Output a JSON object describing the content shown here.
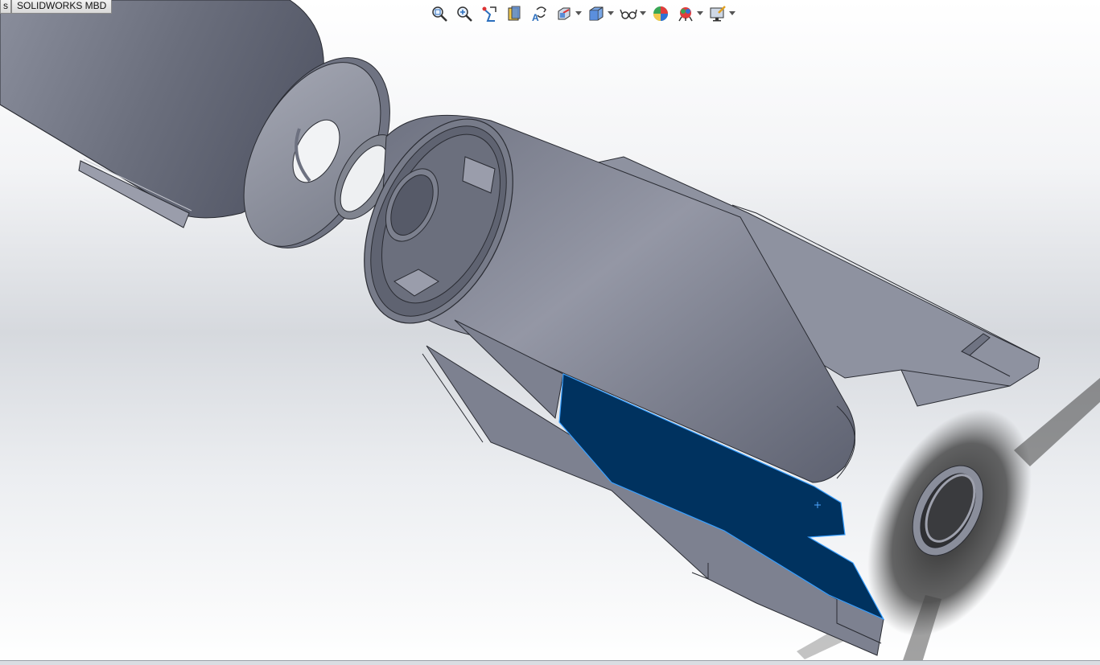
{
  "tabs": [
    {
      "label": "s"
    },
    {
      "label": "SOLIDWORKS MBD"
    }
  ],
  "heads_up_toolbar": [
    {
      "icon": "zoom-to-fit-icon"
    },
    {
      "icon": "zoom-to-area-icon"
    },
    {
      "icon": "previous-view-icon"
    },
    {
      "icon": "section-view-icon"
    },
    {
      "icon": "dynamic-annotation-views-icon"
    },
    {
      "icon": "view-orientation-icon",
      "dropdown": true
    },
    {
      "icon": "display-style-icon",
      "dropdown": true
    },
    {
      "icon": "hide-show-items-icon",
      "dropdown": true
    },
    {
      "icon": "edit-appearance-icon"
    },
    {
      "icon": "apply-scene-icon",
      "dropdown": true
    },
    {
      "icon": "view-settings-icon",
      "dropdown": true
    }
  ],
  "colors": {
    "selected_face": "#00325f",
    "selection_edge": "#3aa0ff",
    "part_body": "#8a8e9c",
    "part_dark": "#5b5f6d",
    "shadow": "#2b2b2b"
  }
}
